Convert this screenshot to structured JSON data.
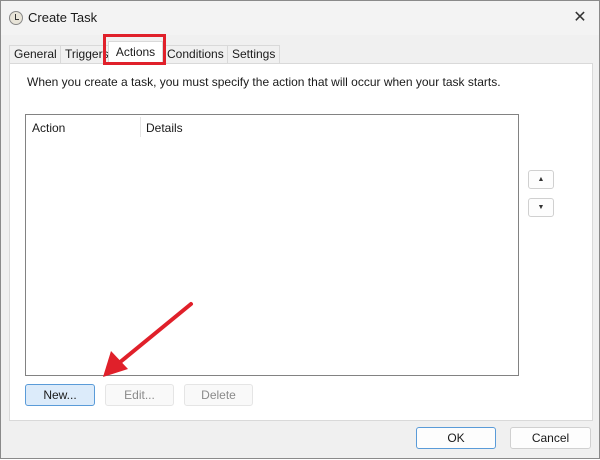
{
  "window": {
    "title": "Create Task",
    "close_icon": "close-icon"
  },
  "tabs": [
    {
      "label": "General"
    },
    {
      "label": "Triggers"
    },
    {
      "label": "Actions",
      "active": true
    },
    {
      "label": "Conditions"
    },
    {
      "label": "Settings"
    }
  ],
  "actions": {
    "description": "When you create a task, you must specify the action that will occur when your task starts.",
    "columns": [
      "Action",
      "Details"
    ],
    "rows": [],
    "new_label": "New...",
    "edit_label": "Edit...",
    "delete_label": "Delete",
    "move_up_icon": "▲",
    "move_down_icon": "▼"
  },
  "footer": {
    "ok_label": "OK",
    "cancel_label": "Cancel"
  },
  "annotation": {
    "highlight_color": "#e0202a"
  }
}
